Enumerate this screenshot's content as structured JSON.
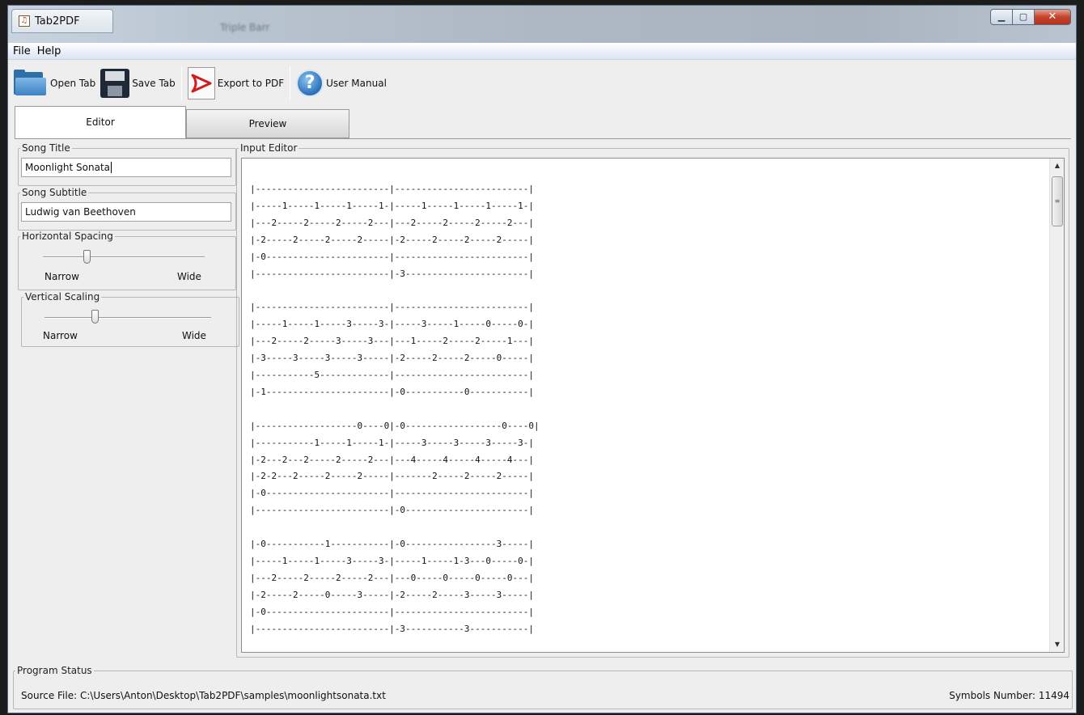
{
  "window": {
    "title": "Tab2PDF",
    "app_icon_glyph": "♫",
    "background_title": "Triple Barr"
  },
  "menu": {
    "items": [
      "File",
      "Help"
    ]
  },
  "toolbar": {
    "open_label": "Open Tab",
    "save_label": "Save Tab",
    "export_label": "Export to PDF",
    "manual_label": "User Manual"
  },
  "tabs": {
    "editor": "Editor",
    "preview": "Preview"
  },
  "left_panel": {
    "song_title_label": "Song Title",
    "song_title_value": "Moonlight Sonata",
    "song_subtitle_label": "Song Subtitle",
    "song_subtitle_value": "Ludwig van Beethoven",
    "horizontal_spacing": {
      "label": "Horizontal Spacing",
      "min_label": "Narrow",
      "max_label": "Wide",
      "value_fraction": 0.27
    },
    "vertical_scaling": {
      "label": "Vertical Scaling",
      "min_label": "Narrow",
      "max_label": "Wide",
      "value_fraction": 0.3
    }
  },
  "editor": {
    "label": "Input Editor",
    "content": "|-------------------------|-------------------------|\n|-----1-----1-----1-----1-|-----1-----1-----1-----1-|\n|---2-----2-----2-----2---|---2-----2-----2-----2---|\n|-2-----2-----2-----2-----|-2-----2-----2-----2-----|\n|-0-----------------------|-------------------------|\n|-------------------------|-3-----------------------|\n\n|-------------------------|-------------------------|\n|-----1-----1-----3-----3-|-----3-----1-----0-----0-|\n|---2-----2-----3-----3---|---1-----2-----2-----1---|\n|-3-----3-----3-----3-----|-2-----2-----2-----0-----|\n|-----------5-------------|-------------------------|\n|-1-----------------------|-0-----------0-----------|\n\n|-------------------0----0|-0------------------0----0|\n|-----------1-----1-----1-|-----3-----3-----3-----3-|\n|-2---2---2-----2-----2---|---4-----4-----4-----4---|\n|-2-2---2-----2-----2-----|-------2-----2-----2-----|\n|-0-----------------------|-------------------------|\n|-------------------------|-0-----------------------|\n\n|-0-----------1-----------|-0-----------------3-----|\n|-----1-----1-----3-----3-|-----1-----1-3---0-----0-|\n|---2-----2-----2-----2---|---0-----0-----0-----0---|\n|-2-----2-----0-----3-----|-2-----2-----3-----3-----|\n|-0-----------------------|-------------------------|\n|-------------------------|-3-----------3-----------|",
    "scroll_fraction": 0.0
  },
  "status": {
    "label": "Program Status",
    "source_file": "Source File: C:\\Users\\Anton\\Desktop\\Tab2PDF\\samples\\moonlightsonata.txt",
    "symbols": "Symbols Number: 11494"
  }
}
